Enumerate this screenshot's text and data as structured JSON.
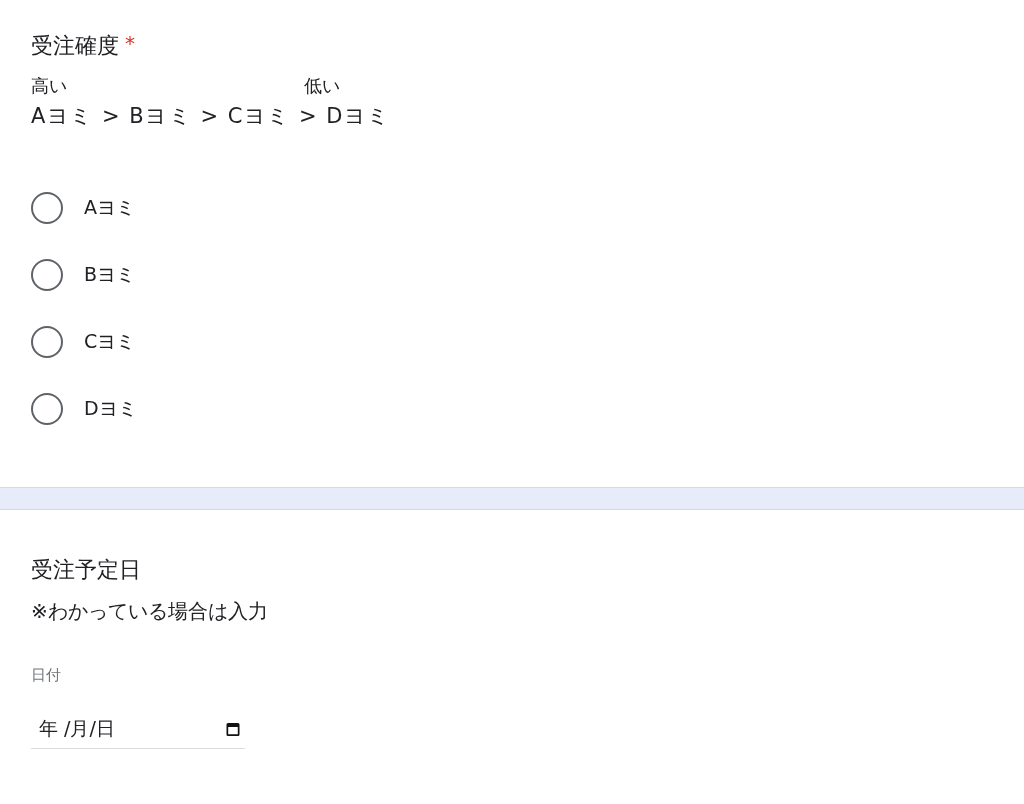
{
  "questions": [
    {
      "kind": "radio",
      "title": "受注確度",
      "required": true,
      "required_mark": "*",
      "scale_high": "高い",
      "scale_low": "低い",
      "order": "Aヨミ > Bヨミ > Cヨミ > Dヨミ",
      "options": [
        {
          "label": "Aヨミ",
          "selected": false
        },
        {
          "label": "Bヨミ",
          "selected": false
        },
        {
          "label": "Cヨミ",
          "selected": false
        },
        {
          "label": "Dヨミ",
          "selected": false
        }
      ]
    },
    {
      "kind": "date",
      "title": "受注予定日",
      "required": false,
      "description": "※わかっている場合は入力",
      "field_label": "日付",
      "placeholder": "年 /月/日"
    }
  ]
}
